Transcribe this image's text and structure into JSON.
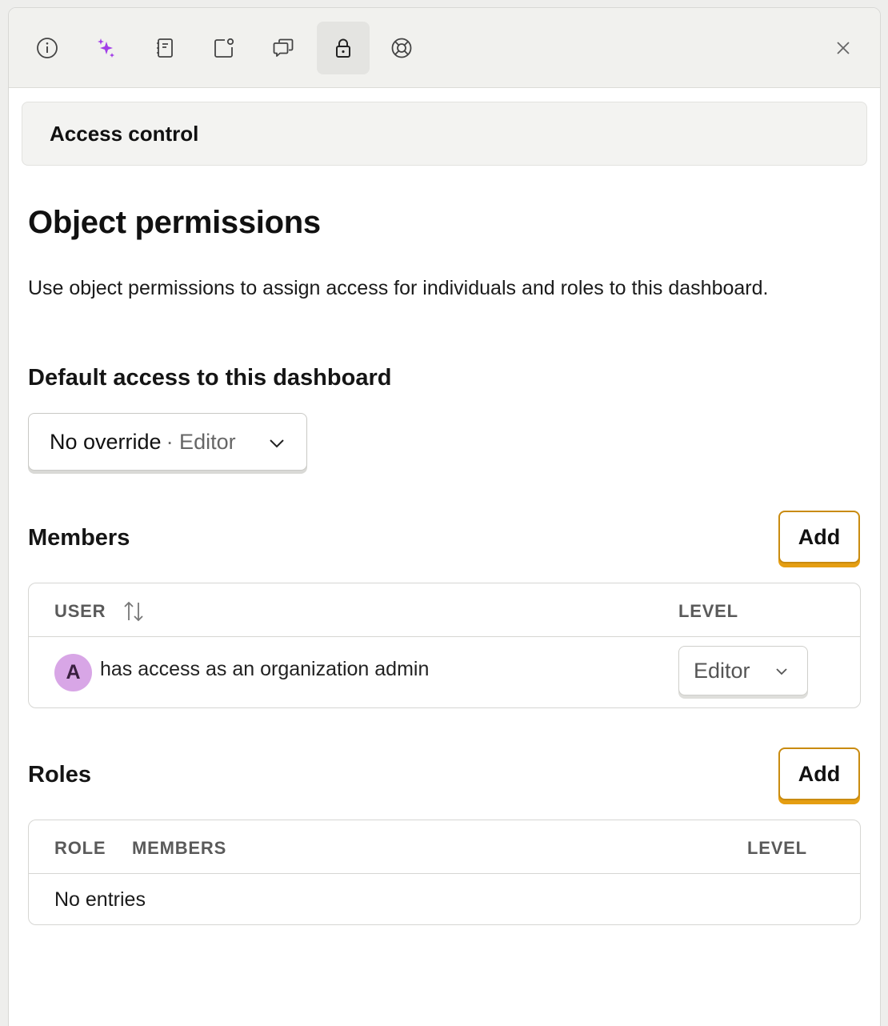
{
  "toolbar": {
    "icons": [
      "info-icon",
      "sparkles-icon",
      "notebook-icon",
      "notes-icon",
      "comments-icon",
      "lock-icon",
      "support-icon"
    ],
    "active": "lock-icon",
    "accent": "#a23ee8"
  },
  "section_header": {
    "title": "Access control"
  },
  "permissions": {
    "title": "Object permissions",
    "description": "Use object permissions to assign access for individuals and roles to this dashboard.",
    "default_access_label": "Default access to this dashboard",
    "default_access_value": "No override",
    "default_access_sub": "· Editor"
  },
  "members": {
    "title": "Members",
    "add_label": "Add",
    "columns": {
      "user": "USER",
      "level": "LEVEL"
    },
    "rows": [
      {
        "avatar_initial": "A",
        "text": "has access as an organization admin",
        "level": "Editor"
      }
    ]
  },
  "roles": {
    "title": "Roles",
    "add_label": "Add",
    "columns": {
      "role": "ROLE",
      "members": "MEMBERS",
      "level": "LEVEL"
    },
    "empty_text": "No entries"
  },
  "colors": {
    "button_border": "#c98b10",
    "button_shadow": "#e59e12",
    "avatar_bg": "#d8a6e6"
  }
}
